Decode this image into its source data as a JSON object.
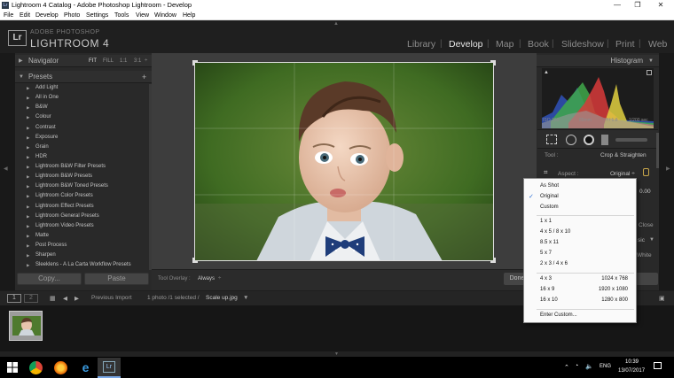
{
  "window": {
    "title": "Lightroom 4 Catalog - Adobe Photoshop Lightroom - Develop",
    "controls": [
      "—",
      "❐",
      "✕"
    ]
  },
  "menu": [
    "File",
    "Edit",
    "Develop",
    "Photo",
    "Settings",
    "Tools",
    "View",
    "Window",
    "Help"
  ],
  "identity": {
    "badge": "Lr",
    "vendor": "ADOBE PHOTOSHOP",
    "product": "LIGHTROOM 4"
  },
  "modules": [
    {
      "label": "Library",
      "active": false
    },
    {
      "label": "Develop",
      "active": true
    },
    {
      "label": "Map",
      "active": false
    },
    {
      "label": "Book",
      "active": false
    },
    {
      "label": "Slideshow",
      "active": false
    },
    {
      "label": "Print",
      "active": false
    },
    {
      "label": "Web",
      "active": false
    }
  ],
  "navigator": {
    "title": "Navigator",
    "zoom_options": [
      "FIT",
      "FILL",
      "1:1",
      "3:1"
    ]
  },
  "presets": {
    "title": "Presets",
    "add": "+",
    "items": [
      "Add Light",
      "All in One",
      "B&W",
      "Colour",
      "Contrast",
      "Exposure",
      "Grain",
      "HDR",
      "Lightroom B&W Filter Presets",
      "Lightroom B&W Presets",
      "Lightroom B&W Toned Presets",
      "Lightroom Color Presets",
      "Lightroom Effect Presets",
      "Lightroom General Presets",
      "Lightroom Video Presets",
      "Matte",
      "Post Process",
      "Sharpen",
      "Sleeklens - A La Carta Workflow Presets"
    ]
  },
  "left_buttons": {
    "copy": "Copy...",
    "paste": "Paste"
  },
  "toolbar": {
    "overlay_label": "Tool Overlay :",
    "overlay_value": "Always",
    "done": "Done"
  },
  "histogram": {
    "title": "Histogram",
    "info": {
      "iso": "ISO 200",
      "focal": "85mm",
      "aperture": "f / 1.8",
      "shutter": "1/200 sec"
    }
  },
  "crop": {
    "tool_label": "Tool :",
    "tool_value": "Crop & Straighten",
    "aspect_label": "Aspect :",
    "aspect_value": "Original ÷",
    "angle_value": "0.00",
    "close_partial": "Close",
    "basic_partial": "sic",
    "white_partial": "White"
  },
  "aspect_menu": {
    "selected": "Original",
    "items": [
      {
        "label": "As Shot"
      },
      {
        "label": "Original",
        "checked": true
      },
      {
        "label": "Custom"
      },
      {
        "separator": true
      },
      {
        "label": "1 x 1"
      },
      {
        "label": "4 x 5  /  8 x 10"
      },
      {
        "label": "8.5 x 11"
      },
      {
        "label": "5 x 7"
      },
      {
        "label": "2 x 3  /  4 x 6"
      },
      {
        "separator": true
      },
      {
        "label": "4 x 3",
        "res": "1024 x 768"
      },
      {
        "label": "16 x 9",
        "res": "1920 x 1080"
      },
      {
        "label": "16 x 10",
        "res": "1280 x 800"
      },
      {
        "separator": true
      },
      {
        "label": "Enter Custom..."
      }
    ]
  },
  "filmstrip": {
    "view1": "1",
    "view2": "2",
    "source": "Previous Import",
    "status": "1 photo /1 selected /",
    "filename": "Scale up.jpg"
  },
  "taskbar": {
    "lang": "ENG",
    "time": "10:39",
    "date": "13/07/2017",
    "colors": {
      "accent": "#2b6fd4"
    }
  },
  "colors": {
    "bg": "#1e1e1e",
    "panel": "#292929",
    "menu_check": "#2b6fd4"
  }
}
